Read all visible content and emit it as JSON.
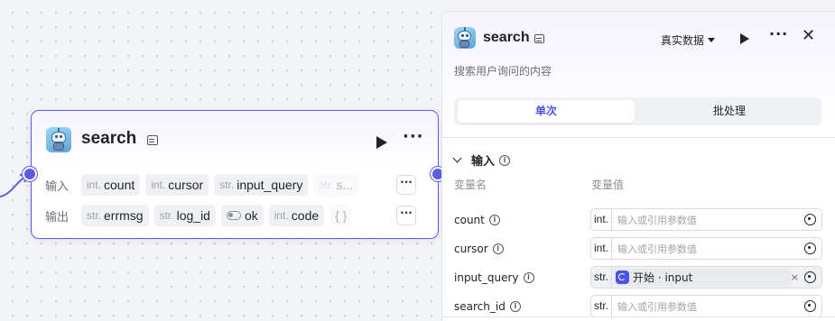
{
  "node": {
    "title": "search",
    "input_label": "输入",
    "output_label": "输出",
    "inputs": [
      {
        "type": "int.",
        "name": "count"
      },
      {
        "type": "int.",
        "name": "cursor"
      },
      {
        "type": "str.",
        "name": "input_query"
      },
      {
        "type": "str.",
        "name": "s..."
      }
    ],
    "outputs": [
      {
        "type": "str.",
        "name": "errmsg"
      },
      {
        "type": "str.",
        "name": "log_id"
      },
      {
        "type": "",
        "name": "ok"
      },
      {
        "type": "int.",
        "name": "code"
      },
      {
        "type": "",
        "name": "{ }"
      }
    ],
    "more": "···"
  },
  "panel": {
    "title": "search",
    "mode_label": "真实数据",
    "more": "···",
    "close": "✕",
    "description": "搜索用户询问的内容",
    "tabs": [
      {
        "label": "单次",
        "active": true
      },
      {
        "label": "批处理",
        "active": false
      }
    ],
    "section_title": "输入",
    "col_name": "变量名",
    "col_value": "变量值",
    "variables": [
      {
        "name": "count",
        "type": "int.",
        "placeholder": "输入或引用参数值"
      },
      {
        "name": "cursor",
        "type": "int.",
        "placeholder": "输入或引用参数值"
      },
      {
        "name": "input_query",
        "type": "str.",
        "ref": "开始 · input"
      },
      {
        "name": "search_id",
        "type": "str.",
        "placeholder": "输入或引用参数值"
      }
    ]
  },
  "colors": {
    "accent": "#5b5ce6",
    "active_tab": "#4d53e8"
  },
  "icons": [
    "robot-avatar-icon",
    "preview-icon",
    "play-icon",
    "more-icon",
    "close-icon",
    "info-icon",
    "reference-icon",
    "start-node-icon"
  ]
}
